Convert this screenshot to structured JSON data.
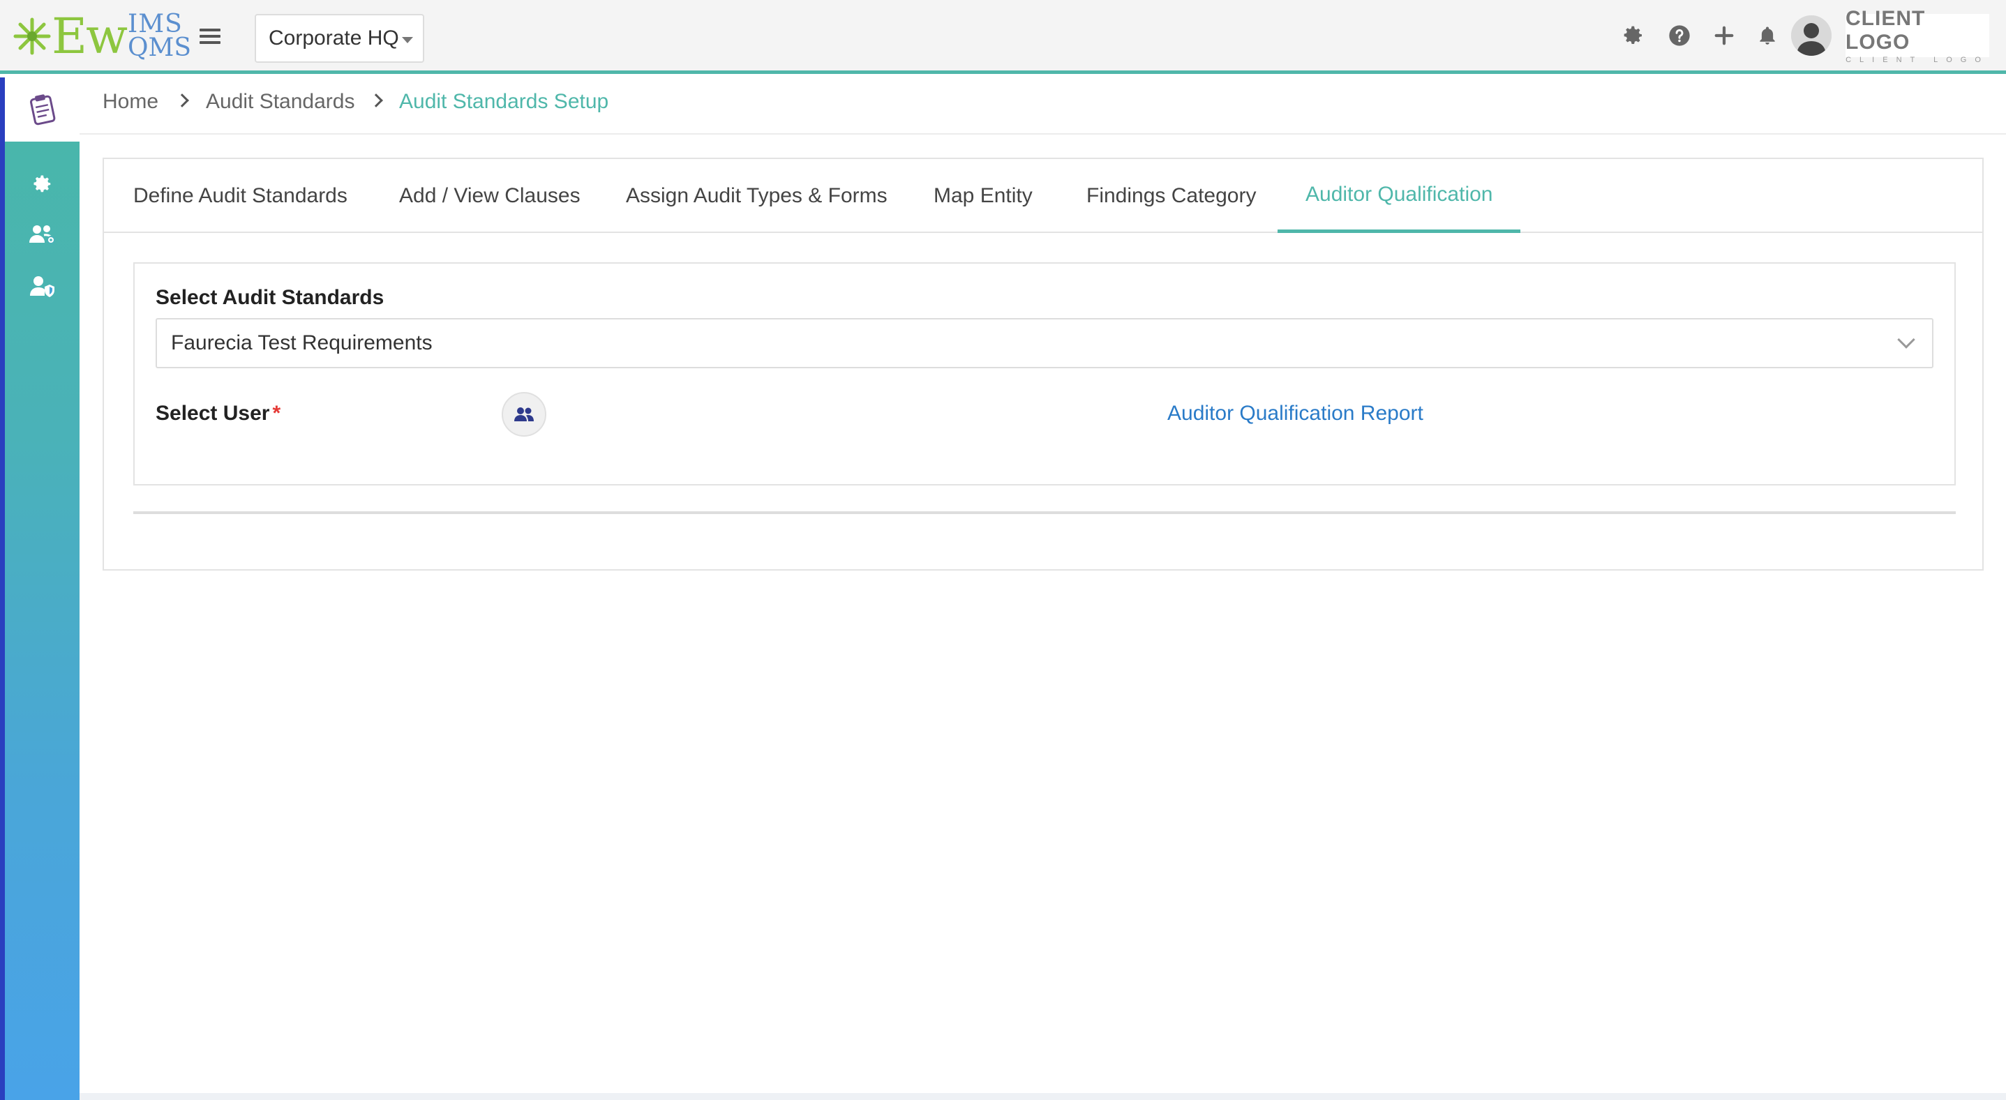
{
  "header": {
    "logo": {
      "main": "Ew",
      "sup_top": "IMS",
      "sup_bottom": "QMS"
    },
    "location": "Corporate HQ",
    "icons": [
      "gear-icon",
      "help-icon",
      "plus-icon",
      "bell-icon"
    ],
    "client_logo": {
      "main": "CLIENT LOGO",
      "sub": "CLIENT LOGO"
    }
  },
  "sidebar": {
    "items": [
      "clipboard-icon",
      "gear-icon",
      "users-gear-icon",
      "user-shield-icon"
    ]
  },
  "breadcrumb": {
    "items": [
      "Home",
      "Audit Standards",
      "Audit Standards Setup"
    ]
  },
  "tabs": [
    {
      "label": "Define Audit Standards",
      "active": false
    },
    {
      "label": "Add / View Clauses",
      "active": false
    },
    {
      "label": "Assign Audit Types & Forms",
      "active": false
    },
    {
      "label": "Map Entity",
      "active": false
    },
    {
      "label": "Findings Category",
      "active": false
    },
    {
      "label": "Auditor Qualification",
      "active": true
    }
  ],
  "form": {
    "standards_label": "Select Audit Standards",
    "standards_value": "Faurecia Test Requirements",
    "user_label": "Select User",
    "required_mark": "*",
    "report_link": "Auditor Qualification Report"
  },
  "colors": {
    "accent": "#4fb7aa",
    "link": "#2a7bc8",
    "required": "#e53935",
    "logo_green": "#8dc63f",
    "logo_blue": "#5b8fcf"
  }
}
